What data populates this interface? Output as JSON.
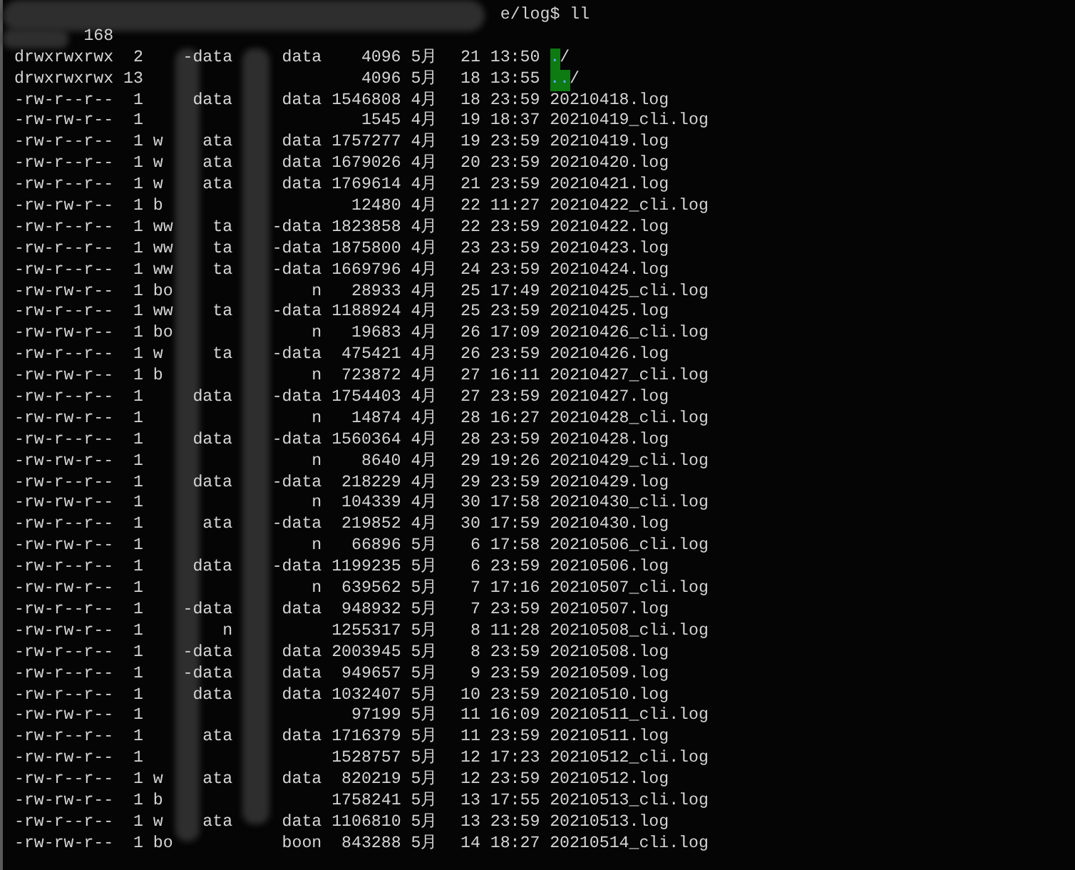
{
  "prompt": {
    "command": "e/log$ ll"
  },
  "total": {
    "text": "168"
  },
  "rows": [
    {
      "kind": "dir",
      "perms": "drwxrwxrwx",
      "links": "2",
      "owner_end": "-data",
      "group": "data",
      "size": "4096",
      "month": "5月",
      "day": "21",
      "time": "13:50",
      "name": ".",
      "suffix": "/"
    },
    {
      "kind": "dir",
      "perms": "drwxrwxrwx",
      "links": "13",
      "size": "4096",
      "month": "5月",
      "day": "18",
      "time": "13:55",
      "name": "..",
      "suffix": "/"
    },
    {
      "kind": "file",
      "perms": "-rw-r--r--",
      "links": "1",
      "owner_end": "data",
      "group": "data",
      "size": "1546808",
      "month": "4月",
      "day": "18",
      "time": "23:59",
      "name": "20210418.log"
    },
    {
      "kind": "file",
      "perms": "-rw-rw-r--",
      "links": "1",
      "size": "1545",
      "month": "4月",
      "day": "19",
      "time": "18:37",
      "name": "20210419_cli.log"
    },
    {
      "kind": "file",
      "perms": "-rw-r--r--",
      "links": "1",
      "owner_start": "w",
      "owner_end": "ata",
      "group": "data",
      "size": "1757277",
      "month": "4月",
      "day": "19",
      "time": "23:59",
      "name": "20210419.log"
    },
    {
      "kind": "file",
      "perms": "-rw-r--r--",
      "links": "1",
      "owner_start": "w",
      "owner_end": "ata",
      "group": "data",
      "size": "1679026",
      "month": "4月",
      "day": "20",
      "time": "23:59",
      "name": "20210420.log"
    },
    {
      "kind": "file",
      "perms": "-rw-r--r--",
      "links": "1",
      "owner_start": "w",
      "owner_end": "ata",
      "group": "data",
      "size": "1769614",
      "month": "4月",
      "day": "21",
      "time": "23:59",
      "name": "20210421.log"
    },
    {
      "kind": "file",
      "perms": "-rw-rw-r--",
      "links": "1",
      "owner_start": "b",
      "size": "12480",
      "month": "4月",
      "day": "22",
      "time": "11:27",
      "name": "20210422_cli.log"
    },
    {
      "kind": "file",
      "perms": "-rw-r--r--",
      "links": "1",
      "owner_start": "ww",
      "owner_end": "ta",
      "group": "-data",
      "size": "1823858",
      "month": "4月",
      "day": "22",
      "time": "23:59",
      "name": "20210422.log"
    },
    {
      "kind": "file",
      "perms": "-rw-r--r--",
      "links": "1",
      "owner_start": "ww",
      "owner_end": "ta",
      "group": "-data",
      "size": "1875800",
      "month": "4月",
      "day": "23",
      "time": "23:59",
      "name": "20210423.log"
    },
    {
      "kind": "file",
      "perms": "-rw-r--r--",
      "links": "1",
      "owner_start": "ww",
      "owner_end": "ta",
      "group": "-data",
      "size": "1669796",
      "month": "4月",
      "day": "24",
      "time": "23:59",
      "name": "20210424.log"
    },
    {
      "kind": "file",
      "perms": "-rw-rw-r--",
      "links": "1",
      "owner_start": "bo",
      "group": "n",
      "size": "28933",
      "month": "4月",
      "day": "25",
      "time": "17:49",
      "name": "20210425_cli.log"
    },
    {
      "kind": "file",
      "perms": "-rw-r--r--",
      "links": "1",
      "owner_start": "ww",
      "owner_end": "ta",
      "group": "-data",
      "size": "1188924",
      "month": "4月",
      "day": "25",
      "time": "23:59",
      "name": "20210425.log"
    },
    {
      "kind": "file",
      "perms": "-rw-rw-r--",
      "links": "1",
      "owner_start": "bo",
      "group": "n",
      "size": "19683",
      "month": "4月",
      "day": "26",
      "time": "17:09",
      "name": "20210426_cli.log"
    },
    {
      "kind": "file",
      "perms": "-rw-r--r--",
      "links": "1",
      "owner_start": "w",
      "owner_end": "ta",
      "group": "-data",
      "size": "475421",
      "month": "4月",
      "day": "26",
      "time": "23:59",
      "name": "20210426.log"
    },
    {
      "kind": "file",
      "perms": "-rw-rw-r--",
      "links": "1",
      "owner_start": "b",
      "group": "n",
      "size": "723872",
      "month": "4月",
      "day": "27",
      "time": "16:11",
      "name": "20210427_cli.log"
    },
    {
      "kind": "file",
      "perms": "-rw-r--r--",
      "links": "1",
      "owner_end": "data",
      "group": "-data",
      "size": "1754403",
      "month": "4月",
      "day": "27",
      "time": "23:59",
      "name": "20210427.log"
    },
    {
      "kind": "file",
      "perms": "-rw-rw-r--",
      "links": "1",
      "group": "n",
      "size": "14874",
      "month": "4月",
      "day": "28",
      "time": "16:27",
      "name": "20210428_cli.log"
    },
    {
      "kind": "file",
      "perms": "-rw-r--r--",
      "links": "1",
      "owner_end": "data",
      "group": "-data",
      "size": "1560364",
      "month": "4月",
      "day": "28",
      "time": "23:59",
      "name": "20210428.log"
    },
    {
      "kind": "file",
      "perms": "-rw-rw-r--",
      "links": "1",
      "group": "n",
      "size": "8640",
      "month": "4月",
      "day": "29",
      "time": "19:26",
      "name": "20210429_cli.log"
    },
    {
      "kind": "file",
      "perms": "-rw-r--r--",
      "links": "1",
      "owner_end": "data",
      "group": "-data",
      "size": "218229",
      "month": "4月",
      "day": "29",
      "time": "23:59",
      "name": "20210429.log"
    },
    {
      "kind": "file",
      "perms": "-rw-rw-r--",
      "links": "1",
      "group": "n",
      "size": "104339",
      "month": "4月",
      "day": "30",
      "time": "17:58",
      "name": "20210430_cli.log"
    },
    {
      "kind": "file",
      "perms": "-rw-r--r--",
      "links": "1",
      "owner_end": "ata",
      "group": "-data",
      "size": "219852",
      "month": "4月",
      "day": "30",
      "time": "17:59",
      "name": "20210430.log"
    },
    {
      "kind": "file",
      "perms": "-rw-rw-r--",
      "links": "1",
      "group": "n",
      "size": "66896",
      "month": "5月",
      "day": "6",
      "time": "17:58",
      "name": "20210506_cli.log"
    },
    {
      "kind": "file",
      "perms": "-rw-r--r--",
      "links": "1",
      "owner_end": "data",
      "group": "-data",
      "size": "1199235",
      "month": "5月",
      "day": "6",
      "time": "23:59",
      "name": "20210506.log"
    },
    {
      "kind": "file",
      "perms": "-rw-rw-r--",
      "links": "1",
      "group": "n",
      "size": "639562",
      "month": "5月",
      "day": "7",
      "time": "17:16",
      "name": "20210507_cli.log"
    },
    {
      "kind": "file",
      "perms": "-rw-r--r--",
      "links": "1",
      "owner_end": "-data",
      "group": "data",
      "size": "948932",
      "month": "5月",
      "day": "7",
      "time": "23:59",
      "name": "20210507.log"
    },
    {
      "kind": "file",
      "perms": "-rw-rw-r--",
      "links": "1",
      "owner_end": "n",
      "size": "1255317",
      "month": "5月",
      "day": "8",
      "time": "11:28",
      "name": "20210508_cli.log"
    },
    {
      "kind": "file",
      "perms": "-rw-r--r--",
      "links": "1",
      "owner_end": "-data",
      "group": "data",
      "size": "2003945",
      "month": "5月",
      "day": "8",
      "time": "23:59",
      "name": "20210508.log"
    },
    {
      "kind": "file",
      "perms": "-rw-r--r--",
      "links": "1",
      "owner_end": "-data",
      "group": "data",
      "size": "949657",
      "month": "5月",
      "day": "9",
      "time": "23:59",
      "name": "20210509.log"
    },
    {
      "kind": "file",
      "perms": "-rw-r--r--",
      "links": "1",
      "owner_end": "data",
      "group": "data",
      "size": "1032407",
      "month": "5月",
      "day": "10",
      "time": "23:59",
      "name": "20210510.log"
    },
    {
      "kind": "file",
      "perms": "-rw-rw-r--",
      "links": "1",
      "size": "97199",
      "month": "5月",
      "day": "11",
      "time": "16:09",
      "name": "20210511_cli.log"
    },
    {
      "kind": "file",
      "perms": "-rw-r--r--",
      "links": "1",
      "owner_end": "ata",
      "group": "data",
      "size": "1716379",
      "month": "5月",
      "day": "11",
      "time": "23:59",
      "name": "20210511.log"
    },
    {
      "kind": "file",
      "perms": "-rw-rw-r--",
      "links": "1",
      "size": "1528757",
      "month": "5月",
      "day": "12",
      "time": "17:23",
      "name": "20210512_cli.log"
    },
    {
      "kind": "file",
      "perms": "-rw-r--r--",
      "links": "1",
      "owner_start": "w",
      "owner_end": "ata",
      "group": "data",
      "size": "820219",
      "month": "5月",
      "day": "12",
      "time": "23:59",
      "name": "20210512.log"
    },
    {
      "kind": "file",
      "perms": "-rw-rw-r--",
      "links": "1",
      "owner_start": "b",
      "size": "1758241",
      "month": "5月",
      "day": "13",
      "time": "17:55",
      "name": "20210513_cli.log"
    },
    {
      "kind": "file",
      "perms": "-rw-r--r--",
      "links": "1",
      "owner_start": "w",
      "owner_end": "ata",
      "group": "data",
      "size": "1106810",
      "month": "5月",
      "day": "13",
      "time": "23:59",
      "name": "20210513.log"
    },
    {
      "kind": "file",
      "perms": "-rw-rw-r--",
      "links": "1",
      "owner_start": "bo",
      "group": "boon",
      "size": "843288",
      "month": "5月",
      "day": "14",
      "time": "18:27",
      "name": "20210514_cli.log"
    }
  ]
}
